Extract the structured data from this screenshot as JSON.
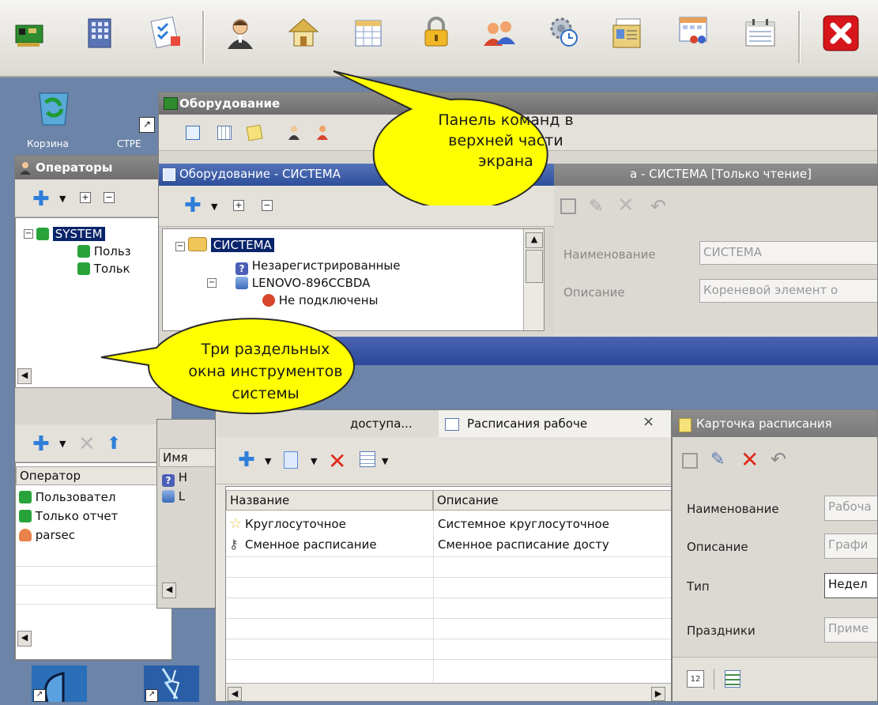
{
  "desktop": {
    "icon_labels": [
      "Корзина",
      "СТРЕ"
    ]
  },
  "command_bar": {
    "close_symbol": "✕"
  },
  "equipment_window": {
    "title": "Оборудование",
    "subwindow_title": "Оборудование - СИСТЕМА",
    "readonly_title": "а - СИСТЕМА [Только чтение]",
    "tree": {
      "root": "СИСТЕМА",
      "items": [
        "Незарегистрированные",
        "LENOVO-896CCBDA",
        "Не подключены"
      ]
    },
    "form": {
      "name_label": "Наименование",
      "name_value": "СИСТЕМА",
      "desc_label": "Описание",
      "desc_value": "Кореневой элемент о"
    }
  },
  "operators_window": {
    "title": "Операторы",
    "tree": {
      "root": "SYSTEM",
      "items": [
        "Польз",
        "Тольк"
      ]
    },
    "list": {
      "header": "Оператор",
      "items": [
        "Пользовател",
        "Только отчет",
        "parsec"
      ]
    }
  },
  "middle_window": {
    "header": "Имя",
    "items": [
      "Н",
      "L"
    ]
  },
  "schedules": {
    "tab_access": "доступа...",
    "tab_work": "Расписания рабоче",
    "tab_close": "×",
    "columns": [
      "Название",
      "Описание"
    ],
    "rows": [
      {
        "name": "Круглосуточное",
        "desc": "Системное круглосуточное"
      },
      {
        "name": "Сменное расписание",
        "desc": "Сменное расписание досту"
      }
    ]
  },
  "schedule_card": {
    "title": "Карточка расписания",
    "fields": [
      {
        "label": "Наименование",
        "value": "Рабоча"
      },
      {
        "label": "Описание",
        "value": "Графи"
      },
      {
        "label": "Тип",
        "value": "Недел"
      },
      {
        "label": "Праздники",
        "value": "Приме"
      }
    ]
  },
  "callouts": {
    "top": [
      "Панель команд в",
      "верхней части",
      "экрана"
    ],
    "left": [
      "Три раздельных",
      "окна инструментов",
      "системы"
    ]
  },
  "colors": {
    "accent_blue": "#0a246a",
    "callout_yellow": "#ffff00",
    "red_close": "#d6161b"
  }
}
